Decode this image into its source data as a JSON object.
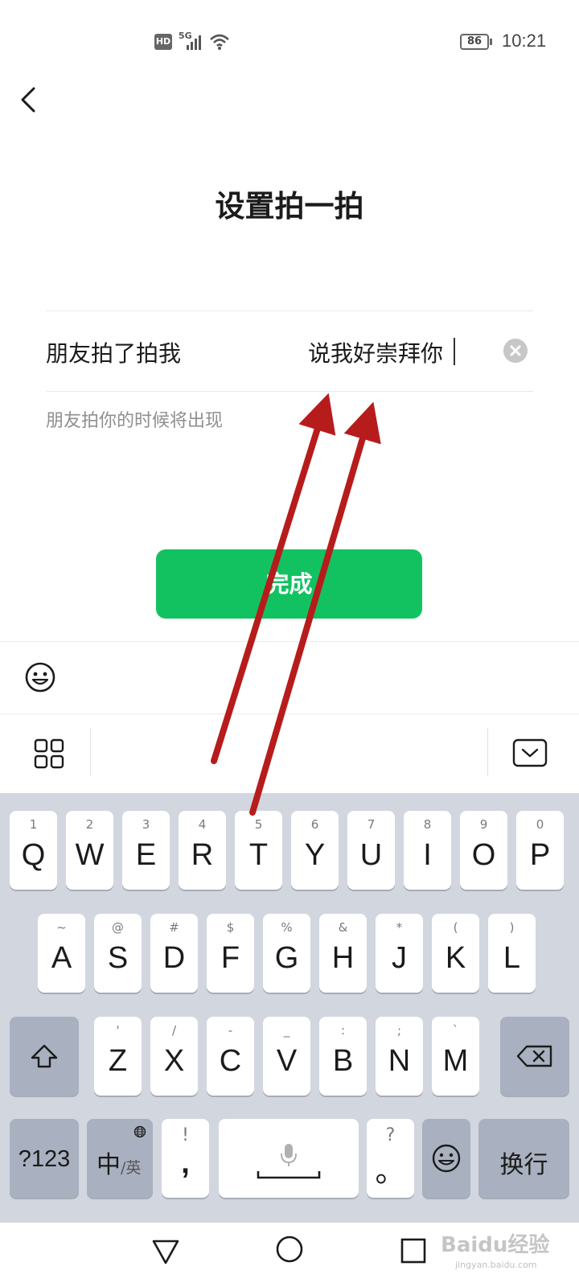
{
  "status_bar": {
    "hd": "HD",
    "network": "5G",
    "battery": "86",
    "time": "10:21"
  },
  "page": {
    "title": "设置拍一拍"
  },
  "pat_field": {
    "prefix": "朋友拍了拍我",
    "value": "说我好崇拜你",
    "hint": "朋友拍你的时候将出现"
  },
  "done_button": {
    "label": "完成",
    "color": "#12c261"
  },
  "keyboard": {
    "row1": [
      {
        "sub": "1",
        "main": "Q"
      },
      {
        "sub": "2",
        "main": "W"
      },
      {
        "sub": "3",
        "main": "E"
      },
      {
        "sub": "4",
        "main": "R"
      },
      {
        "sub": "5",
        "main": "T"
      },
      {
        "sub": "6",
        "main": "Y"
      },
      {
        "sub": "7",
        "main": "U"
      },
      {
        "sub": "8",
        "main": "I"
      },
      {
        "sub": "9",
        "main": "O"
      },
      {
        "sub": "0",
        "main": "P"
      }
    ],
    "row2": [
      {
        "sub": "~",
        "main": "A"
      },
      {
        "sub": "@",
        "main": "S"
      },
      {
        "sub": "#",
        "main": "D"
      },
      {
        "sub": "$",
        "main": "F"
      },
      {
        "sub": "%",
        "main": "G"
      },
      {
        "sub": "&",
        "main": "H"
      },
      {
        "sub": "*",
        "main": "J"
      },
      {
        "sub": "(",
        "main": "K"
      },
      {
        "sub": ")",
        "main": "L"
      }
    ],
    "row3": [
      {
        "sub": "'",
        "main": "Z"
      },
      {
        "sub": "/",
        "main": "X"
      },
      {
        "sub": "-",
        "main": "C"
      },
      {
        "sub": "_",
        "main": "V"
      },
      {
        "sub": ":",
        "main": "B"
      },
      {
        "sub": ";",
        "main": "N"
      },
      {
        "sub": "`",
        "main": "M"
      }
    ],
    "symbols_key": "?123",
    "lang_key_main": "中",
    "lang_key_alt": "/英",
    "comma_key": {
      "sub": "!",
      "main": ","
    },
    "period_key": {
      "sub": "?",
      "main": "。"
    },
    "enter_key": "换行"
  },
  "watermark": {
    "logo": "Baidu经验",
    "url": "jingyan.baidu.com"
  },
  "annotation_color": "#b71c1c"
}
